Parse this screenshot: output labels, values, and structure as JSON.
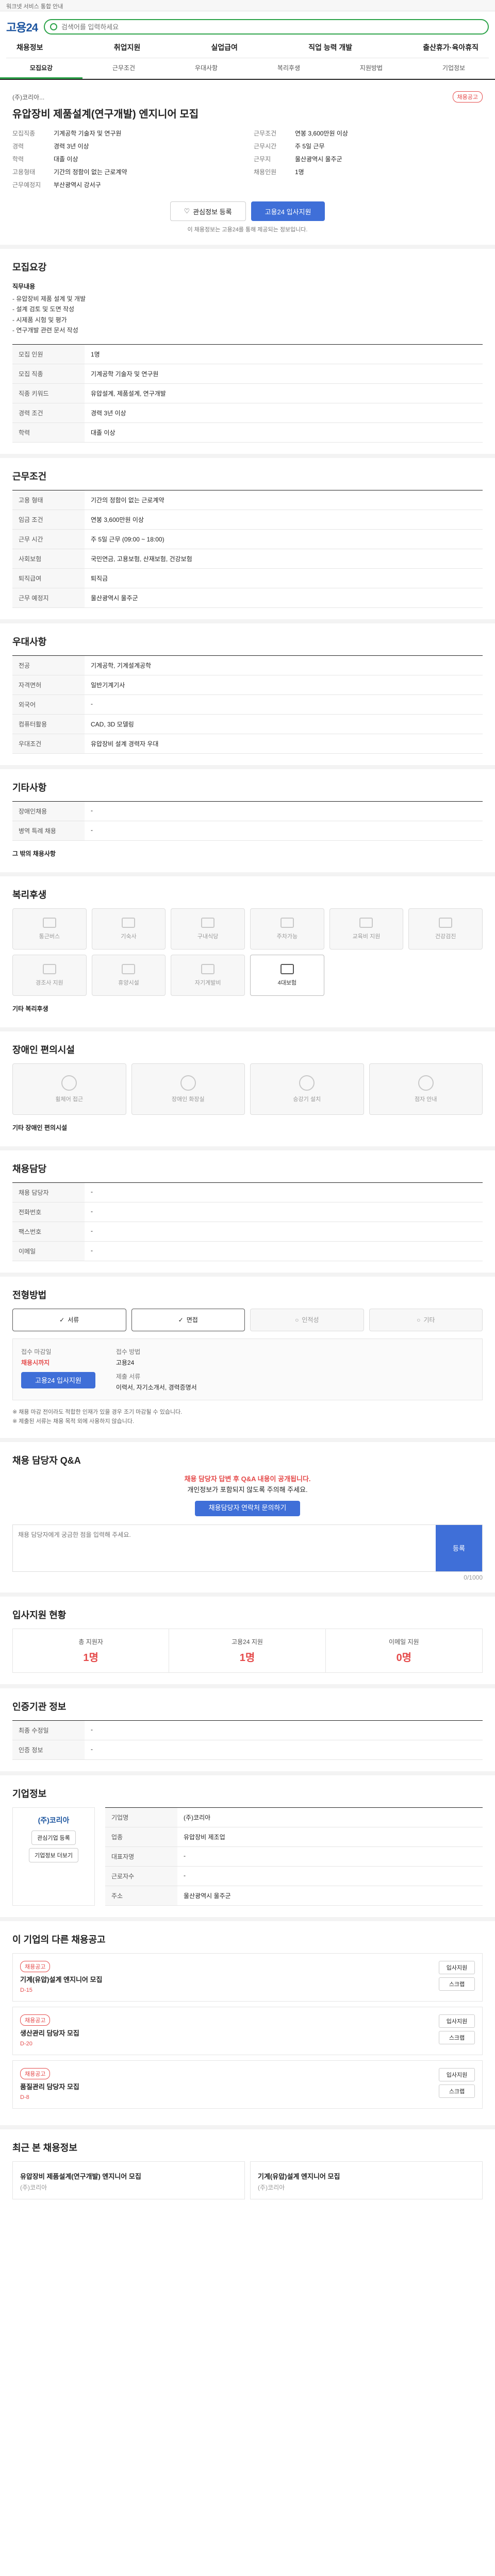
{
  "topbar": {
    "text": "워크넷 서비스 통합 안내"
  },
  "header": {
    "logo": "고용24",
    "search_placeholder": "검색어를 입력하세요"
  },
  "gnb": [
    "채용정보",
    "취업지원",
    "실업급여",
    "직업 능력 개발",
    "출산휴가·육아휴직"
  ],
  "tabs": [
    "모집요강",
    "근무조건",
    "우대사항",
    "복리후생",
    "지원방법",
    "기업정보"
  ],
  "job": {
    "org": "(주)코리아...",
    "title": "유압장비 제품설계(연구개발) 엔지니어 모집",
    "badge": "채용공고",
    "left": [
      {
        "k": "모집직종",
        "v": "기계공학 기술자 및 연구원"
      },
      {
        "k": "경력",
        "v": "경력 3년 이상"
      },
      {
        "k": "학력",
        "v": "대졸 이상"
      },
      {
        "k": "고용형태",
        "v": "기간의 정함이 없는 근로계약"
      },
      {
        "k": "근무예정지",
        "v": "부산광역시 강서구"
      }
    ],
    "right": [
      {
        "k": "근무조건",
        "v": "연봉 3,600만원 이상"
      },
      {
        "k": "근무시간",
        "v": "주 5일 근무"
      },
      {
        "k": "근무지",
        "v": "울산광역시 울주군"
      },
      {
        "k": "채용인원",
        "v": "1명"
      }
    ],
    "btn_interest": "관심정보 등록",
    "btn_apply": "고용24 입사지원",
    "note": "이 채용정보는 고용24를 통해 제공되는 정보입니다."
  },
  "recruit": {
    "title": "모집요강",
    "duties_label": "직무내용",
    "duties": "- 유압장비 제품 설계 및 개발\n- 설계 검토 및 도면 작성\n- 시제품 시험 및 평가\n- 연구개발 관련 문서 작성",
    "rows": [
      {
        "k": "모집 인원",
        "v": "1명"
      },
      {
        "k": "모집 직종",
        "v": "기계공학 기술자 및 연구원"
      },
      {
        "k": "직종 키워드",
        "v": "유압설계, 제품설계, 연구개발"
      },
      {
        "k": "경력 조건",
        "v": "경력 3년 이상"
      },
      {
        "k": "학력",
        "v": "대졸 이상"
      }
    ]
  },
  "conditions": {
    "title": "근무조건",
    "rows": [
      {
        "k": "고용 형태",
        "v": "기간의 정함이 없는 근로계약"
      },
      {
        "k": "임금 조건",
        "v": "연봉 3,600만원 이상"
      },
      {
        "k": "근무 시간",
        "v": "주 5일 근무 (09:00 ~ 18:00)"
      },
      {
        "k": "사회보험",
        "v": "국민연금, 고용보험, 산재보험, 건강보험"
      },
      {
        "k": "퇴직급여",
        "v": "퇴직금"
      },
      {
        "k": "근무 예정지",
        "v": "울산광역시 울주군"
      }
    ]
  },
  "preferences": {
    "title": "우대사항",
    "rows": [
      {
        "k": "전공",
        "v": "기계공학, 기계설계공학"
      },
      {
        "k": "자격면허",
        "v": "일반기계기사"
      },
      {
        "k": "외국어",
        "v": "-"
      },
      {
        "k": "컴퓨터활용",
        "v": "CAD, 3D 모델링"
      },
      {
        "k": "우대조건",
        "v": "유압장비 설계 경력자 우대"
      }
    ]
  },
  "other": {
    "title": "기타사항",
    "rows": [
      {
        "k": "장애인채용",
        "v": "-"
      },
      {
        "k": "병역 특례 채용",
        "v": "-"
      }
    ],
    "cert_label": "그 밖의 채용사항"
  },
  "welfare": {
    "title": "복리후생",
    "items": [
      {
        "label": "통근버스",
        "on": false
      },
      {
        "label": "기숙사",
        "on": false
      },
      {
        "label": "구내식당",
        "on": false
      },
      {
        "label": "주차가능",
        "on": false
      },
      {
        "label": "교육비 지원",
        "on": false
      },
      {
        "label": "건강검진",
        "on": false
      },
      {
        "label": "경조사 지원",
        "on": false
      },
      {
        "label": "휴양시설",
        "on": false
      },
      {
        "label": "자기계발비",
        "on": false
      },
      {
        "label": "4대보험",
        "on": true
      }
    ],
    "extra_label": "기타 복리후생"
  },
  "access": {
    "title": "장애인 편의시설",
    "items": [
      "휠체어 접근",
      "장애인 화장실",
      "승강기 설치",
      "점자 안내"
    ],
    "extra_label": "기타 장애인 편의시설"
  },
  "contact": {
    "title": "채용담당",
    "rows": [
      {
        "k": "채용 담당자",
        "v": "-"
      },
      {
        "k": "전화번호",
        "v": "-"
      },
      {
        "k": "팩스번호",
        "v": "-"
      },
      {
        "k": "이메일",
        "v": "-"
      }
    ]
  },
  "apply": {
    "title": "전형방법",
    "methods": [
      {
        "label": "서류",
        "on": true
      },
      {
        "label": "면접",
        "on": true
      },
      {
        "label": "인적성",
        "on": false
      },
      {
        "label": "기타",
        "on": false
      }
    ],
    "deadline_label": "접수 마감일",
    "deadline": "채용시까지",
    "method_label": "접수 방법",
    "method_value": "고용24",
    "btn_apply": "고용24 입사지원",
    "docs_label": "제출 서류",
    "docs": "이력서, 자기소개서, 경력증명서",
    "notes": "※ 채용 마감 전이라도 적합한 인재가 있을 경우 조기 마감될 수 있습니다.\n※ 제출된 서류는 채용 목적 외에 사용하지 않습니다."
  },
  "qna": {
    "title": "채용 담당자 Q&A",
    "alert_main": "채용 담당자 답변 후 Q&A 내용이 공개됩니다.",
    "alert_sub": "개인정보가 포함되지 않도록 주의해 주세요.",
    "btn": "채용담당자 연락처 문의하기",
    "placeholder": "채용 담당자에게 궁금한 점을 입력해 주세요.",
    "send": "등록",
    "counter": "0/1000"
  },
  "status": {
    "title": "입사지원 현황",
    "stats": [
      {
        "label": "총 지원자",
        "value": "1명"
      },
      {
        "label": "고용24 지원",
        "value": "1명"
      },
      {
        "label": "이메일 지원",
        "value": "0명"
      }
    ]
  },
  "info": {
    "title": "인증기관 정보",
    "rows": [
      {
        "k": "최종 수정일",
        "v": "-"
      },
      {
        "k": "인증 정보",
        "v": "-"
      }
    ]
  },
  "company": {
    "title": "기업정보",
    "logo": "(주)코리아",
    "rows": [
      {
        "k": "기업명",
        "v": "(주)코리아"
      },
      {
        "k": "업종",
        "v": "유압장비 제조업"
      },
      {
        "k": "대표자명",
        "v": "-"
      },
      {
        "k": "근로자수",
        "v": "-"
      },
      {
        "k": "주소",
        "v": "울산광역시 울주군"
      }
    ],
    "btn_follow": "관심기업 등록",
    "btn_more": "기업정보 더보기"
  },
  "related": {
    "title": "이 기업의 다른 채용공고",
    "cards": [
      {
        "badge": "채용공고",
        "title": "기계(유압)설계 엔지니어 모집",
        "dday": "D-15"
      },
      {
        "badge": "채용공고",
        "title": "생산관리 담당자 모집",
        "dday": "D-20"
      },
      {
        "badge": "채용공고",
        "title": "품질관리 담당자 모집",
        "dday": "D-8"
      }
    ],
    "btn_apply": "입사지원",
    "btn_scrap": "스크랩"
  },
  "recent": {
    "title": "최근 본 채용정보",
    "cards": [
      {
        "title": "유압장비 제품설계(연구개발) 엔지니어 모집",
        "org": "(주)코리아"
      },
      {
        "title": "기계(유압)설계 엔지니어 모집",
        "org": "(주)코리아"
      }
    ]
  }
}
